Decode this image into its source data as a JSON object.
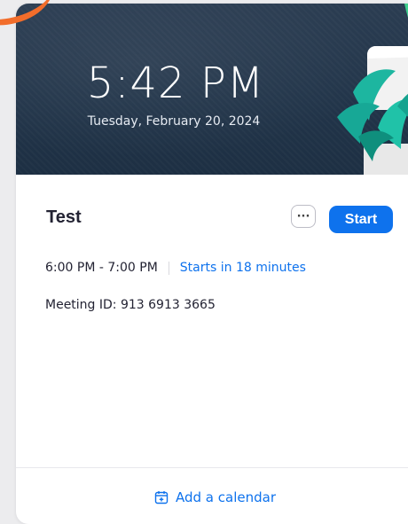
{
  "clock": {
    "time": "5:42 PM",
    "date": "Tuesday, February 20, 2024"
  },
  "meeting": {
    "title": "Test",
    "more_label": "···",
    "start_label": "Start",
    "time_range": "6:00 PM - 7:00 PM",
    "starts_in": "Starts in 18 minutes",
    "meeting_id": "Meeting ID: 913 6913 3665"
  },
  "footer": {
    "add_calendar_label": "Add a calendar",
    "icon": "calendar-add-icon"
  },
  "colors": {
    "accent": "#0e72ed",
    "hero_bg": "#22354a",
    "corner_accent": "#f26d2b"
  }
}
